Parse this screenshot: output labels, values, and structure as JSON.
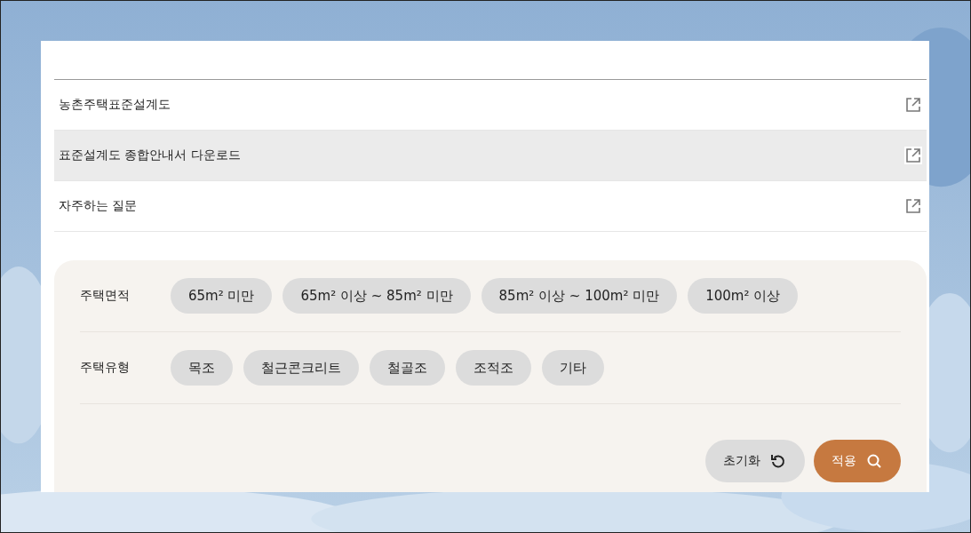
{
  "links": [
    {
      "label": "농촌주택표준설계도",
      "highlighted": false
    },
    {
      "label": "표준설계도 종합안내서 다운로드",
      "highlighted": true
    },
    {
      "label": "자주하는 질문",
      "highlighted": false
    }
  ],
  "filters": [
    {
      "label": "주택면적",
      "options": [
        {
          "label": "65m² 미만",
          "selected": false
        },
        {
          "label": "65m² 이상 ~ 85m² 미만",
          "selected": false
        },
        {
          "label": "85m² 이상 ~ 100m² 미만",
          "selected": false
        },
        {
          "label": "100m² 이상",
          "selected": false
        }
      ]
    },
    {
      "label": "주택유형",
      "options": [
        {
          "label": "목조",
          "selected": false
        },
        {
          "label": "철근콘크리트",
          "selected": false
        },
        {
          "label": "철골조",
          "selected": false
        },
        {
          "label": "조적조",
          "selected": false
        },
        {
          "label": "기타",
          "selected": false
        }
      ]
    }
  ],
  "actions": [
    {
      "label": "초기화",
      "kind": "reset"
    },
    {
      "label": "적용",
      "kind": "apply"
    }
  ]
}
